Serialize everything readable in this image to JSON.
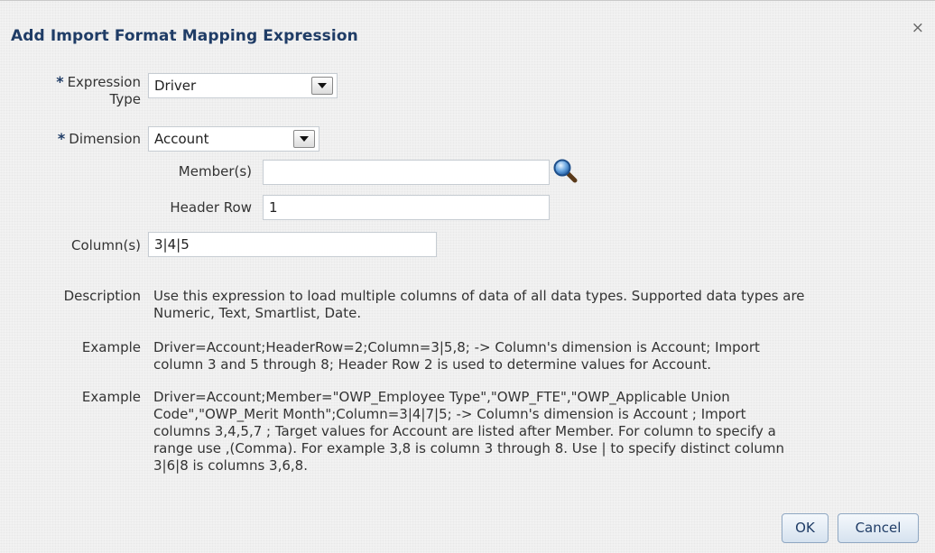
{
  "dialog": {
    "title": "Add Import Format Mapping Expression",
    "close_glyph": "×"
  },
  "form": {
    "required_marker": "*",
    "expression_type": {
      "label_line1": "Expression",
      "label_line2": "Type",
      "value": "Driver"
    },
    "dimension": {
      "label": "Dimension",
      "value": "Account"
    },
    "members": {
      "label": "Member(s)",
      "value": ""
    },
    "header_row": {
      "label": "Header Row",
      "value": "1"
    },
    "columns": {
      "label": "Column(s)",
      "value": "3|4|5"
    }
  },
  "info": {
    "description_label": "Description",
    "description_lines": [
      "Use this expression to load multiple columns of data of all data types. Supported data types are",
      "Numeric, Text, Smartlist, Date."
    ],
    "example1_label": "Example",
    "example1_lines": [
      "Driver=Account;HeaderRow=2;Column=3|5,8; -> Column's dimension is Account; Import",
      "column 3 and 5 through 8; Header Row 2 is used to determine values for Account."
    ],
    "example2_label": "Example",
    "example2_lines": [
      "Driver=Account;Member=\"OWP_Employee Type\",\"OWP_FTE\",\"OWP_Applicable Union",
      "Code\",\"OWP_Merit Month\";Column=3|4|7|5; -> Column's dimension is Account ; Import",
      "columns 3,4,5,7 ; Target values for Account are listed after Member. For column to specify a",
      "range use ,(Comma). For example 3,8 is column 3 through 8. Use | to specify distinct column",
      "3|6|8 is columns 3,6,8."
    ]
  },
  "buttons": {
    "ok": "OK",
    "cancel": "Cancel"
  },
  "icons": {
    "member_lookup": "search-icon",
    "dropdown": "chevron-down-icon",
    "close": "close-icon"
  },
  "colors": {
    "title": "#1f3c66",
    "button_border": "#8fa7c2"
  }
}
